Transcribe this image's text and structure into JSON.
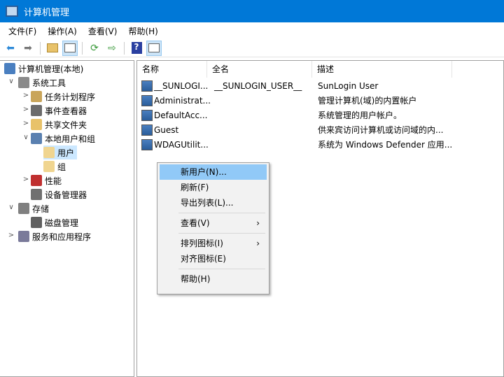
{
  "window": {
    "title": "计算机管理"
  },
  "menu": [
    "文件(F)",
    "操作(A)",
    "查看(V)",
    "帮助(H)"
  ],
  "toolbar": [
    "back-icon",
    "forward-icon",
    "up-folder-icon",
    "show-hide-tree-icon",
    "refresh-icon",
    "export-list-icon",
    "help-icon",
    "show-action-pane-icon"
  ],
  "tree": [
    {
      "label": "计算机管理(本地)",
      "level": 0,
      "exp": "",
      "icon": "computer-icon",
      "color": "#4a7fc0"
    },
    {
      "label": "系统工具",
      "level": 1,
      "exp": "∨",
      "icon": "tools-icon",
      "color": "#8a8a8a"
    },
    {
      "label": "任务计划程序",
      "level": 2,
      "exp": ">",
      "icon": "clock-icon",
      "color": "#c9a55a"
    },
    {
      "label": "事件查看器",
      "level": 2,
      "exp": ">",
      "icon": "event-viewer-icon",
      "color": "#6b6b6b"
    },
    {
      "label": "共享文件夹",
      "level": 2,
      "exp": ">",
      "icon": "shared-folder-icon",
      "color": "#e8c26a"
    },
    {
      "label": "本地用户和组",
      "level": 2,
      "exp": "∨",
      "icon": "users-icon",
      "color": "#5a80b0"
    },
    {
      "label": "用户",
      "level": 3,
      "exp": "",
      "icon": "folder-icon",
      "color": "#f0d590",
      "selected": true
    },
    {
      "label": "组",
      "level": 3,
      "exp": "",
      "icon": "folder-icon",
      "color": "#f0d590"
    },
    {
      "label": "性能",
      "level": 2,
      "exp": ">",
      "icon": "performance-icon",
      "color": "#c03030"
    },
    {
      "label": "设备管理器",
      "level": 2,
      "exp": "",
      "icon": "device-manager-icon",
      "color": "#707070"
    },
    {
      "label": "存储",
      "level": 1,
      "exp": "∨",
      "icon": "storage-icon",
      "color": "#808080"
    },
    {
      "label": "磁盘管理",
      "level": 2,
      "exp": "",
      "icon": "disk-icon",
      "color": "#606060"
    },
    {
      "label": "服务和应用程序",
      "level": 1,
      "exp": ">",
      "icon": "services-icon",
      "color": "#7a7a9a"
    }
  ],
  "columns": [
    "名称",
    "全名",
    "描述"
  ],
  "users": [
    {
      "name": "__SUNLOGI...",
      "fullname": "__SUNLOGIN_USER__",
      "desc": "SunLogin User"
    },
    {
      "name": "Administrat...",
      "fullname": "",
      "desc": "管理计算机(域)的内置帐户"
    },
    {
      "name": "DefaultAcc...",
      "fullname": "",
      "desc": "系统管理的用户帐户。"
    },
    {
      "name": "Guest",
      "fullname": "",
      "desc": "供来宾访问计算机或访问域的内..."
    },
    {
      "name": "WDAGUtilit...",
      "fullname": "",
      "desc": "系统为 Windows Defender 应用..."
    }
  ],
  "context_menu": [
    {
      "label": "新用户(N)...",
      "highlighted": true
    },
    {
      "label": "刷新(F)"
    },
    {
      "label": "导出列表(L)..."
    },
    {
      "sep": true
    },
    {
      "label": "查看(V)",
      "submenu": true
    },
    {
      "sep": true
    },
    {
      "label": "排列图标(I)",
      "submenu": true
    },
    {
      "label": "对齐图标(E)"
    },
    {
      "sep": true
    },
    {
      "label": "帮助(H)"
    }
  ],
  "submenu_arrow": "›"
}
